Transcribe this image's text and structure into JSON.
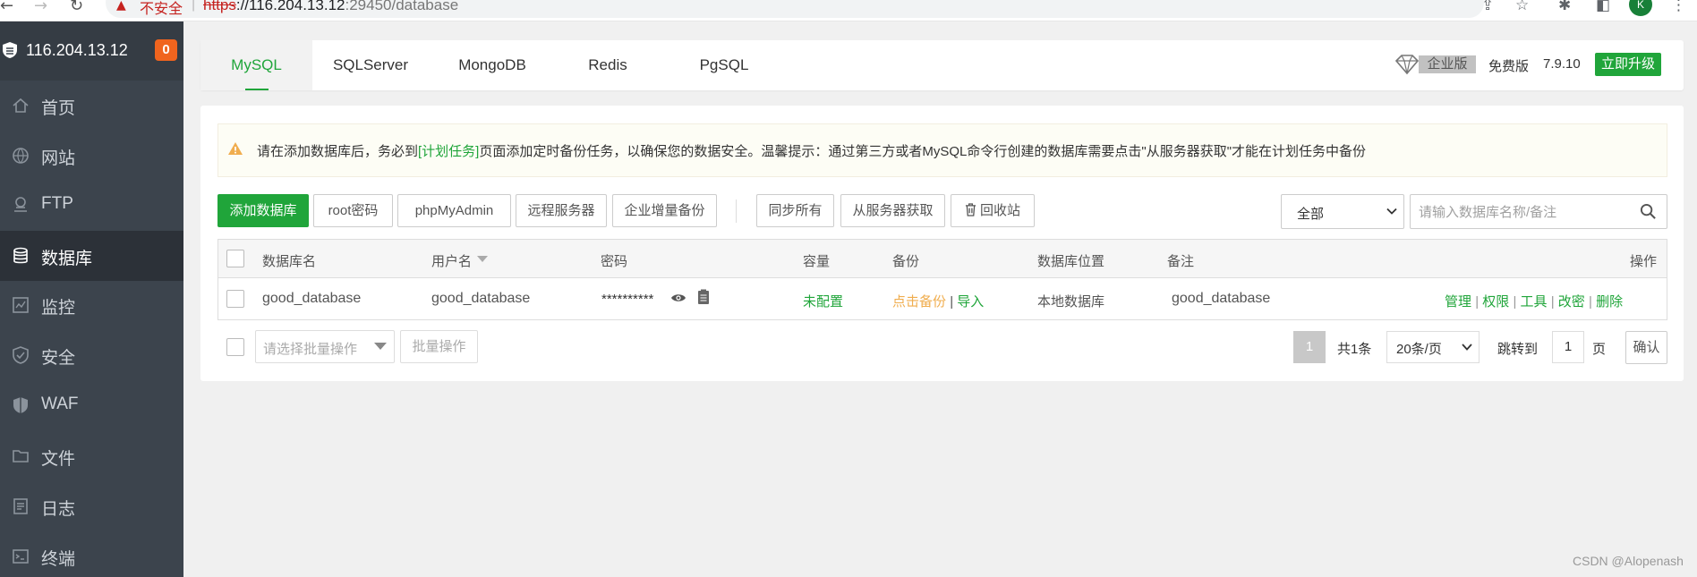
{
  "browser": {
    "not_secure": "不安全",
    "separator": "|",
    "url_scheme": "https",
    "url_host": "://116.204.13.12",
    "url_port_path": ":29450/database",
    "profile_initial": "K"
  },
  "sidebar": {
    "server_ip": "116.204.13.12",
    "message_count": "0",
    "items": [
      {
        "label": "首页",
        "icon": "home-icon"
      },
      {
        "label": "网站",
        "icon": "globe-icon"
      },
      {
        "label": "FTP",
        "icon": "ftp-icon"
      },
      {
        "label": "数据库",
        "icon": "database-icon",
        "active": true
      },
      {
        "label": "监控",
        "icon": "monitor-icon"
      },
      {
        "label": "安全",
        "icon": "shield-check-icon"
      },
      {
        "label": "WAF",
        "icon": "waf-shield-icon"
      },
      {
        "label": "文件",
        "icon": "folder-icon"
      },
      {
        "label": "日志",
        "icon": "log-icon"
      },
      {
        "label": "终端",
        "icon": "terminal-icon"
      }
    ]
  },
  "tabs": {
    "items": [
      "MySQL",
      "SQLServer",
      "MongoDB",
      "Redis",
      "PgSQL"
    ],
    "active": "MySQL"
  },
  "edition": {
    "enterprise": "企业版",
    "free": "免费版",
    "version": "7.9.10",
    "upgrade": "立即升级"
  },
  "notice": {
    "before": "请在添加数据库后，务必到",
    "link": "[计划任务]",
    "after": "页面添加定时备份任务，以确保您的数据安全。温馨提示：通过第三方或者MySQL命令行创建的数据库需要点击\"从服务器获取\"才能在计划任务中备份"
  },
  "toolbar": {
    "add_database": "添加数据库",
    "root_password": "root密码",
    "phpmyadmin": "phpMyAdmin",
    "remote_server": "远程服务器",
    "enterprise_backup": "企业增量备份",
    "sync_all": "同步所有",
    "fetch_from_server": "从服务器获取",
    "recycle_bin": "回收站"
  },
  "filter": {
    "selected": "全部",
    "search_placeholder": "请输入数据库名称/备注"
  },
  "table": {
    "headers": {
      "name": "数据库名",
      "user": "用户名",
      "password": "密码",
      "capacity": "容量",
      "backup": "备份",
      "location": "数据库位置",
      "note": "备注",
      "actions": "操作"
    },
    "rows": [
      {
        "name": "good_database",
        "user": "good_database",
        "password": "**********",
        "capacity": "未配置",
        "backup_link": "点击备份",
        "backup_sep": "|",
        "import_link": "导入",
        "location": "本地数据库",
        "note": "good_database",
        "actions": [
          "管理",
          "权限",
          "工具",
          "改密",
          "删除"
        ],
        "action_sep": "|"
      }
    ]
  },
  "batch": {
    "select_placeholder": "请选择批量操作",
    "button": "批量操作"
  },
  "pagination": {
    "current": "1",
    "total": "共1条",
    "page_size": "20条/页",
    "jump_label": "跳转到",
    "jump_value": "1",
    "page_unit": "页",
    "confirm": "确认"
  },
  "watermark": "CSDN @Alopenash",
  "colors": {
    "accent": "#20a53a",
    "sidebar_bg": "#3c444d",
    "badge": "#f0641e",
    "warning": "#f0ad4e"
  }
}
